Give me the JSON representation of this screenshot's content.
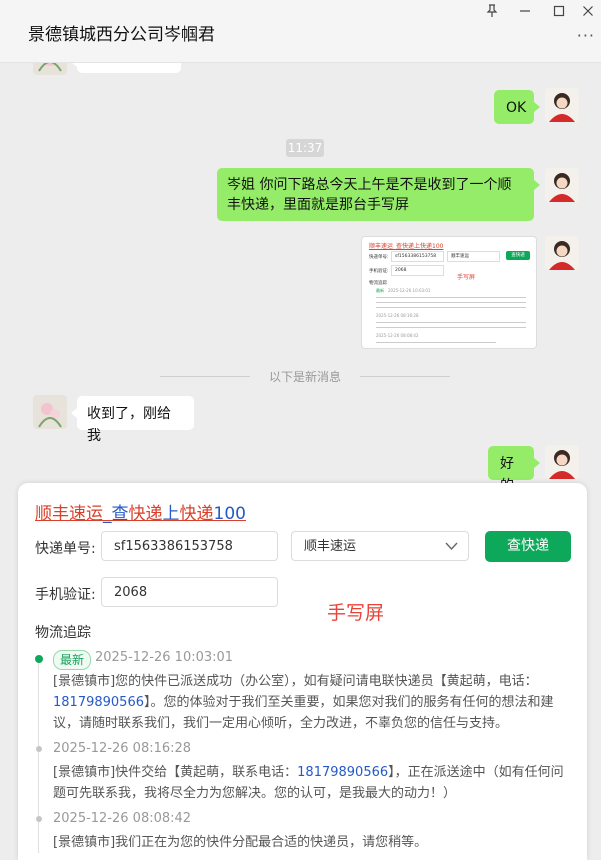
{
  "window": {
    "title": "景德镇城西分公司岑帼君",
    "pin_glyph": "⊥",
    "min_glyph": "—",
    "max_glyph": "☐",
    "close_glyph": "✕",
    "more_glyph": "···"
  },
  "chat": {
    "messages": [
      {
        "from": "me",
        "text": "OK"
      },
      {
        "time": "11:37"
      },
      {
        "from": "me",
        "text": "岑姐 你问下路总今天上午是不是收到了一个顺丰快递，里面就是那台手写屏"
      },
      {
        "from": "me",
        "image": true
      },
      {
        "divider": "以下是新消息"
      },
      {
        "from": "other",
        "text": "收到了，刚给我"
      },
      {
        "from": "me",
        "text": "好的"
      }
    ]
  },
  "tracker": {
    "title_parts": [
      "顺丰速运",
      "_查",
      "快递",
      "上",
      "快递",
      "100"
    ],
    "number_label": "快递单号:",
    "number_value": "sf1563386153758",
    "carrier_selected": "顺丰速运",
    "search_button": "查快递",
    "phone_label": "手机验证:",
    "phone_value": "2068",
    "annotation": "手写屏",
    "track_label": "物流追踪",
    "latest_badge": "最新",
    "events": [
      {
        "time": "2025-12-26 10:03:01",
        "text_before": "[景德镇市]您的快件已派送成功（办公室），如有疑问请电联快递员【黄起萌，电话：",
        "phone": "18179890566",
        "text_after": "】。您的体验对于我们至关重要，如果您对我们的服务有任何的想法和建议，请随时联系我们，我们一定用心倾听，全力改进，不辜负您的信任与支持。"
      },
      {
        "time": "2025-12-26 08:16:28",
        "text_before": "[景德镇市]快件交给【黄起萌，联系电话：",
        "phone": "18179890566",
        "text_after": "】，正在派送途中（如有任何问题可先联系我，我将尽全力为您解决。您的认可，是我最大的动力！）"
      },
      {
        "time": "2025-12-26 08:08:42",
        "text_before": "[景德镇市]我们正在为您的快件分配最合适的快递员，请您稍等。",
        "phone": "",
        "text_after": ""
      }
    ]
  },
  "thumbnail": {
    "title": "顺丰速运_查快递上快递100",
    "number_label": "快递单号:",
    "number_value": "sf1563386153758",
    "carrier": "顺丰速运",
    "button": "查快递",
    "phone_label": "手机验证:",
    "phone_value": "2068",
    "annotation": "手写屏",
    "track_label": "物流追踪",
    "badge": "最新",
    "time1": "2025-12-26 10:03:01",
    "time2": "2025-12-26 08:16:28",
    "time3": "2025-12-26 08:08:42"
  },
  "colors": {
    "my_bubble": "#95ec69",
    "other_bubble": "#ffffff",
    "button_green": "#0ea85a",
    "annotation_red": "#e8433a",
    "link_blue": "#2559c8"
  }
}
